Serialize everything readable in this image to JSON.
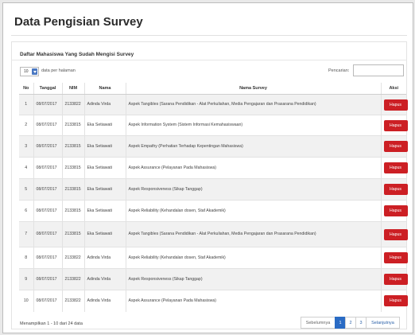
{
  "page": {
    "title": "Data Pengisian Survey"
  },
  "panel": {
    "heading": "Daftar Mahasiswa Yang Sudah Mengisi Survey"
  },
  "controls": {
    "length_value": "10",
    "length_label": "data per halaman",
    "search_label": "Pencarian:",
    "search_value": ""
  },
  "table": {
    "headers": [
      "No",
      "Tanggal",
      "NIM",
      "Nama",
      "Nama Survey",
      "Aksi"
    ],
    "rows": [
      {
        "no": "1",
        "tanggal": "08/07/2017",
        "nim": "2133822",
        "nama": "Adinda Virda",
        "survey": "Aspek Tangibles (Sarana Pendidikan - Alat Perkuliahan, Media Pengajaran dan Prasarana Pendidikan)",
        "aksi": "Hapus"
      },
      {
        "no": "2",
        "tanggal": "08/07/2017",
        "nim": "2133815",
        "nama": "Eka Setiawati",
        "survey": "Aspek Information System (Sistem Informasi Kemahasiswaan)",
        "aksi": "Hapus"
      },
      {
        "no": "3",
        "tanggal": "08/07/2017",
        "nim": "2133815",
        "nama": "Eka Setiawati",
        "survey": "Aspek Empathy (Perhatian Terhadap Kepentingan Mahasiswa)",
        "aksi": "Hapus"
      },
      {
        "no": "4",
        "tanggal": "08/07/2017",
        "nim": "2133815",
        "nama": "Eka Setiawati",
        "survey": "Aspek Assurance (Pelayanan Pada Mahasiswa)",
        "aksi": "Hapus"
      },
      {
        "no": "5",
        "tanggal": "08/07/2017",
        "nim": "2133815",
        "nama": "Eka Setiawati",
        "survey": "Aspek Responsiveness (Sikap Tanggap)",
        "aksi": "Hapus"
      },
      {
        "no": "6",
        "tanggal": "08/07/2017",
        "nim": "2133815",
        "nama": "Eka Setiawati",
        "survey": "Aspek Reliability (Kehandalan dosen, Staf Akademik)",
        "aksi": "Hapus"
      },
      {
        "no": "7",
        "tanggal": "08/07/2017",
        "nim": "2133815",
        "nama": "Eka Setiawati",
        "survey": "Aspek Tangibles (Sarana Pendidikan - Alat Perkuliahan, Media Pengajaran dan Prasarana Pendidikan)",
        "aksi": "Hapus"
      },
      {
        "no": "8",
        "tanggal": "08/07/2017",
        "nim": "2133822",
        "nama": "Adinda Virda",
        "survey": "Aspek Reliability (Kehandalan dosen, Staf Akademik)",
        "aksi": "Hapus"
      },
      {
        "no": "9",
        "tanggal": "08/07/2017",
        "nim": "2133822",
        "nama": "Adinda Virda",
        "survey": "Aspek Responsiveness (Sikap Tanggap)",
        "aksi": "Hapus"
      },
      {
        "no": "10",
        "tanggal": "08/07/2017",
        "nim": "2133822",
        "nama": "Adinda Virda",
        "survey": "Aspek Assurance (Pelayanan Pada Mahasiswa)",
        "aksi": "Hapus"
      }
    ]
  },
  "footer": {
    "info": "Menampilkan 1 - 10 dari 24 data",
    "pagination": {
      "prev": "Sebelumnya",
      "pages": [
        "1",
        "2",
        "3"
      ],
      "active_page": "1",
      "next": "Selanjutnya"
    }
  },
  "colors": {
    "delete_button": "#cc1f24",
    "active_page": "#2a6bc4",
    "stripe": "#f1f1f1"
  }
}
